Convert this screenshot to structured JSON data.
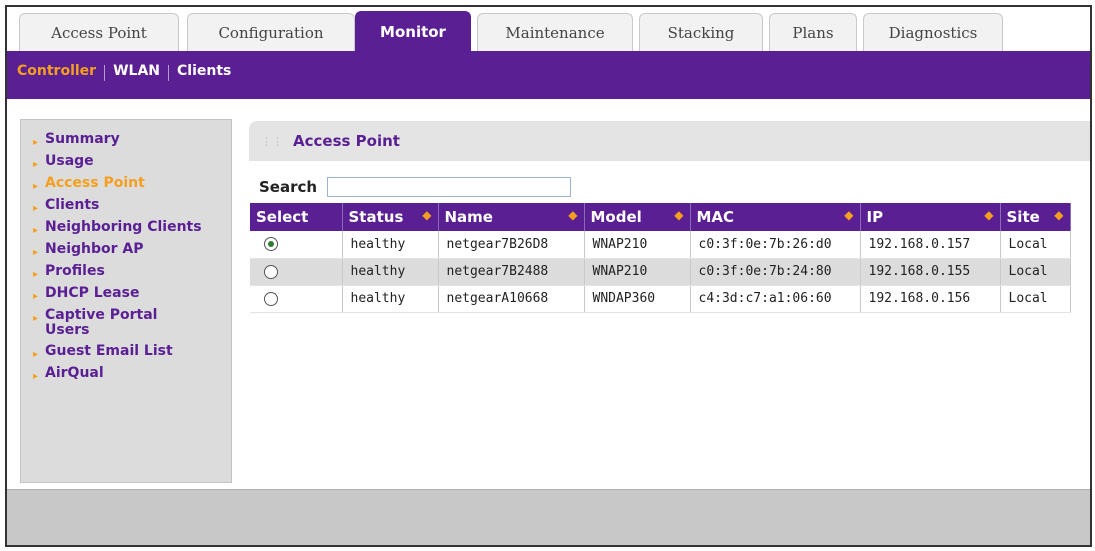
{
  "tabs": [
    {
      "label": "Access Point"
    },
    {
      "label": "Configuration"
    },
    {
      "label": "Monitor"
    },
    {
      "label": "Maintenance"
    },
    {
      "label": "Stacking"
    },
    {
      "label": "Plans"
    },
    {
      "label": "Diagnostics"
    }
  ],
  "active_tab": "Monitor",
  "subnav": [
    {
      "label": "Controller"
    },
    {
      "label": "WLAN"
    },
    {
      "label": "Clients"
    }
  ],
  "active_subnav": "Controller",
  "sidebar": [
    {
      "label": "Summary"
    },
    {
      "label": "Usage"
    },
    {
      "label": "Access Point"
    },
    {
      "label": "Clients"
    },
    {
      "label": "Neighboring Clients"
    },
    {
      "label": "Neighbor AP"
    },
    {
      "label": "Profiles"
    },
    {
      "label": "DHCP Lease"
    },
    {
      "label": "Captive Portal Users"
    },
    {
      "label": "Guest Email List"
    },
    {
      "label": "AirQual"
    }
  ],
  "active_sidebar": "Access Point",
  "panel": {
    "title": "Access Point",
    "search_label": "Search",
    "search_value": ""
  },
  "table": {
    "columns": [
      "Select",
      "Status",
      "Name",
      "Model",
      "MAC",
      "IP",
      "Site"
    ],
    "rows": [
      {
        "selected": true,
        "status": "healthy",
        "name": "netgear7B26D8",
        "model": "WNAP210",
        "mac": "c0:3f:0e:7b:26:d0",
        "ip": "192.168.0.157",
        "site": "Local"
      },
      {
        "selected": false,
        "status": "healthy",
        "name": "netgear7B2488",
        "model": "WNAP210",
        "mac": "c0:3f:0e:7b:24:80",
        "ip": "192.168.0.155",
        "site": "Local"
      },
      {
        "selected": false,
        "status": "healthy",
        "name": "netgearA10668",
        "model": "WNDAP360",
        "mac": "c4:3d:c7:a1:06:60",
        "ip": "192.168.0.156",
        "site": "Local"
      }
    ]
  },
  "colors": {
    "brand_purple": "#5a1f93",
    "accent_orange": "#f4a01e",
    "radio_selected": "#2e7d32"
  },
  "icons": {
    "sort": "sort-arrows-icon",
    "sidebar_bullet": "chevron-right-icon",
    "panel_grip": "grip-icon"
  }
}
